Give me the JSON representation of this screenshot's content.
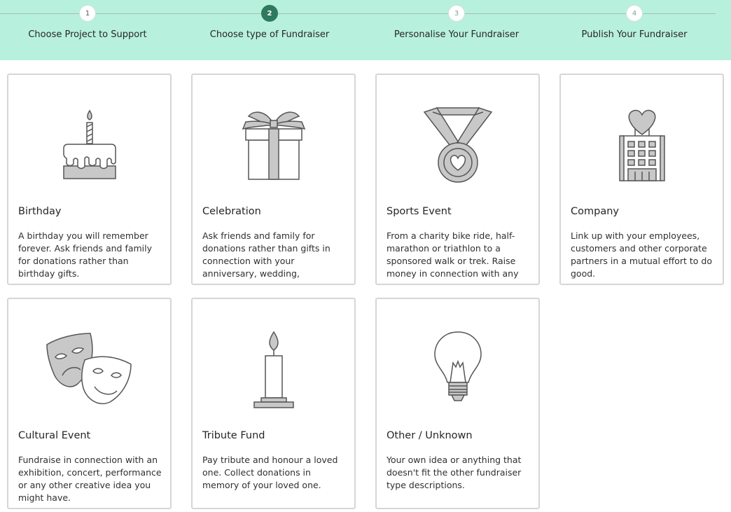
{
  "stepper": {
    "steps": [
      {
        "number": "1",
        "label": "Choose Project to Support",
        "state": "done"
      },
      {
        "number": "2",
        "label": "Choose type of Fundraiser",
        "state": "active"
      },
      {
        "number": "3",
        "label": "Personalise Your Fundraiser",
        "state": "pending"
      },
      {
        "number": "4",
        "label": "Publish Your Fundraiser",
        "state": "pending"
      }
    ]
  },
  "colors": {
    "stepper_bg": "#b8f0de",
    "active_step": "#2e7a5e",
    "icon_fill": "#c8c8c8",
    "icon_stroke": "#555555",
    "card_border": "#d6d6d6"
  },
  "cards": [
    {
      "icon": "birthday-cake-icon",
      "title": "Birthday",
      "description": "A birthday you will remember forever. Ask friends and family for donations rather than birthday gifts."
    },
    {
      "icon": "gift-box-icon",
      "title": "Celebration",
      "description": "Ask friends and family for donations rather than gifts in connection with your anniversary, wedding,"
    },
    {
      "icon": "medal-icon",
      "title": "Sports Event",
      "description": "From a charity bike ride, half-marathon or triathlon to a sponsored walk or trek. Raise money in connection with any"
    },
    {
      "icon": "company-building-icon",
      "title": "Company",
      "description": "Link up with your employees, customers and other corporate partners in a mutual effort to do good."
    },
    {
      "icon": "theatre-masks-icon",
      "title": "Cultural Event",
      "description": "Fundraise in connection with an exhibition, concert, performance or any other creative idea you might have."
    },
    {
      "icon": "candle-icon",
      "title": "Tribute Fund",
      "description": "Pay tribute and honour a loved one. Collect donations in memory of your loved one."
    },
    {
      "icon": "lightbulb-icon",
      "title": "Other / Unknown",
      "description": "Your own idea or anything that doesn't fit the other fundraiser type descriptions."
    }
  ]
}
